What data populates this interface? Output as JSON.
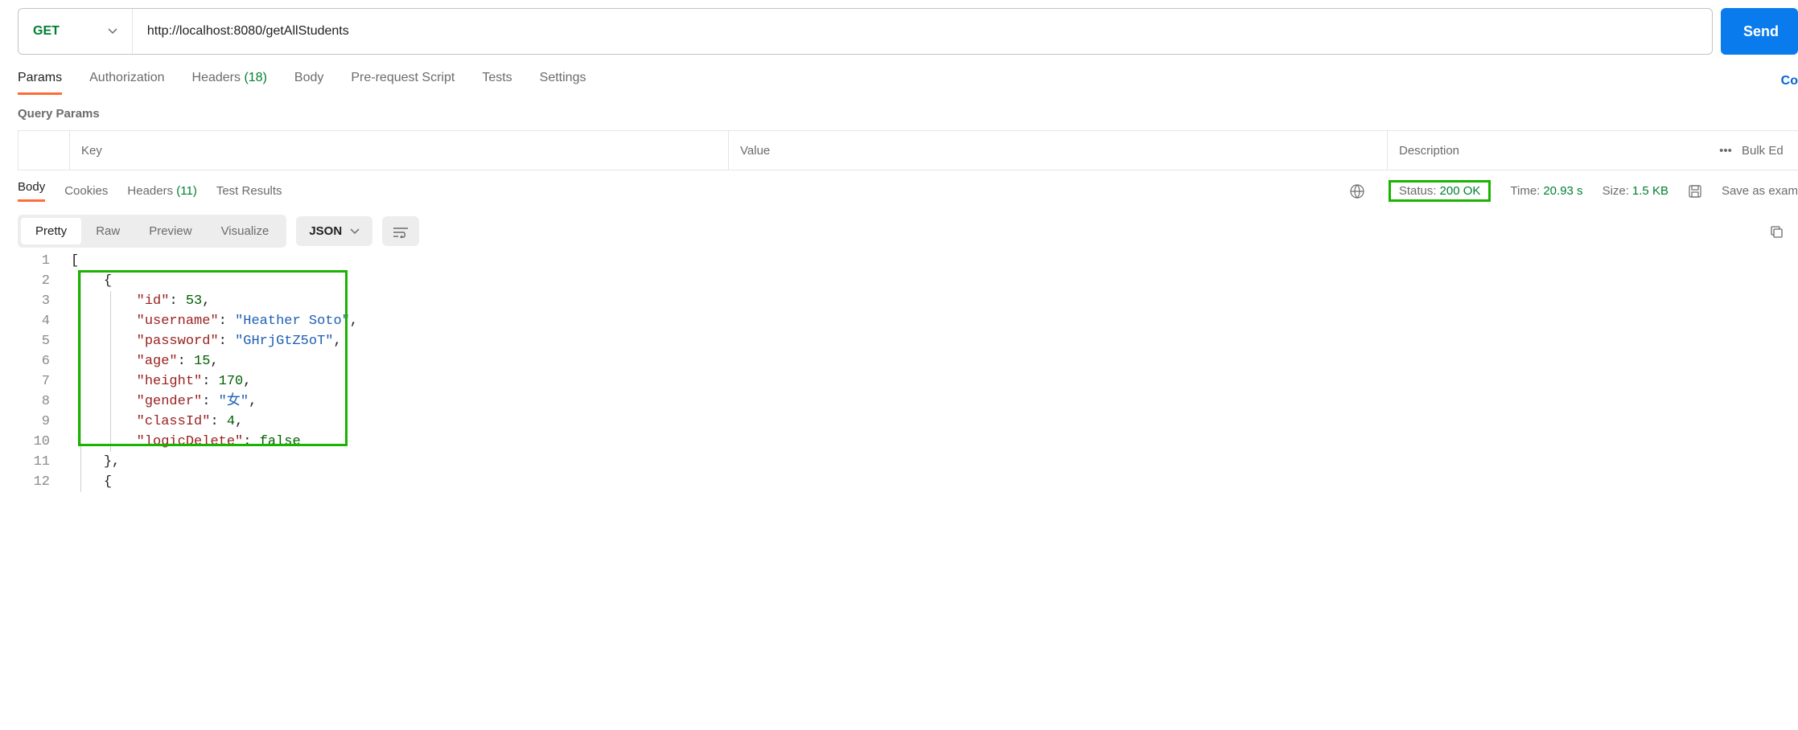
{
  "request": {
    "method": "GET",
    "url": "http://localhost:8080/getAllStudents",
    "send_label": "Send"
  },
  "request_tabs": {
    "params": "Params",
    "authorization": "Authorization",
    "headers": "Headers",
    "headers_count": "(18)",
    "body": "Body",
    "prerequest": "Pre-request Script",
    "tests": "Tests",
    "settings": "Settings",
    "cookies_link": "Co"
  },
  "query_params": {
    "heading": "Query Params",
    "key_header": "Key",
    "value_header": "Value",
    "description_header": "Description",
    "bulk_edit": "Bulk Ed"
  },
  "response_tabs": {
    "body": "Body",
    "cookies": "Cookies",
    "headers": "Headers",
    "headers_count": "(11)",
    "test_results": "Test Results"
  },
  "response_meta": {
    "status_label": "Status:",
    "status_value": "200 OK",
    "time_label": "Time:",
    "time_value": "20.93 s",
    "size_label": "Size:",
    "size_value": "1.5 KB",
    "save_as": "Save as exam"
  },
  "view": {
    "pretty": "Pretty",
    "raw": "Raw",
    "preview": "Preview",
    "visualize": "Visualize",
    "language": "JSON"
  },
  "response_body": {
    "lines": [
      "1",
      "2",
      "3",
      "4",
      "5",
      "6",
      "7",
      "8",
      "9",
      "10",
      "11",
      "12"
    ],
    "obj": {
      "id_key": "\"id\"",
      "id_val": "53",
      "username_key": "\"username\"",
      "username_val": "\"Heather Soto\"",
      "password_key": "\"password\"",
      "password_val": "\"GHrjGtZ5oT\"",
      "age_key": "\"age\"",
      "age_val": "15",
      "height_key": "\"height\"",
      "height_val": "170",
      "gender_key": "\"gender\"",
      "gender_val": "\"女\"",
      "classId_key": "\"classId\"",
      "classId_val": "4",
      "logicDelete_key": "\"logicDelete\"",
      "logicDelete_val": "false"
    }
  }
}
